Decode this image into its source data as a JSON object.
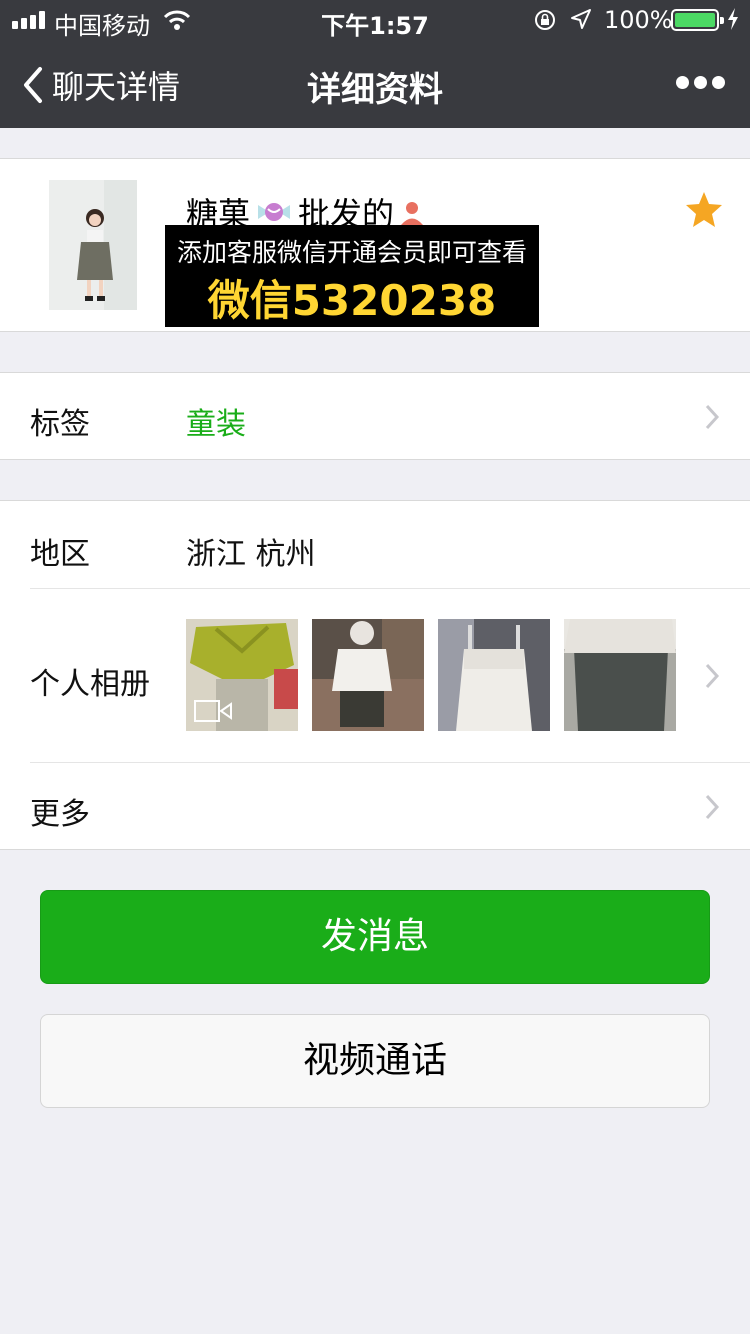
{
  "status_bar": {
    "carrier": "中国移动",
    "time": "下午1:57",
    "battery_percent": "100%",
    "battery_level": 1.0
  },
  "nav": {
    "back_label": "聊天详情",
    "title": "详细资料"
  },
  "profile": {
    "name_part1": "糖菓",
    "name_part2": "批发的",
    "starred": true,
    "ad_line1": "添加客服微信开通会员即可查看",
    "ad_line2": "微信5320238"
  },
  "tags": {
    "label": "标签",
    "value": "童装",
    "value_color": "#1aad19"
  },
  "region": {
    "label": "地区",
    "value": "浙江 杭州"
  },
  "album": {
    "label": "个人相册",
    "photos": [
      {
        "name": "photo-1",
        "has_video": true
      },
      {
        "name": "photo-2",
        "has_video": false
      },
      {
        "name": "photo-3",
        "has_video": false
      },
      {
        "name": "photo-4",
        "has_video": false
      }
    ]
  },
  "more": {
    "label": "更多"
  },
  "actions": {
    "message_label": "发消息",
    "video_call_label": "视频通话"
  },
  "colors": {
    "nav_bg": "#393a3f",
    "primary_button": "#1aad19",
    "star": "#f5a623",
    "page_bg": "#efeff4"
  }
}
